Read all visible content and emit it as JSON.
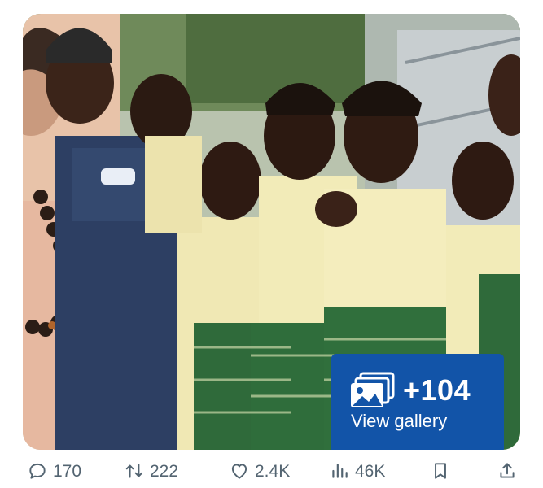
{
  "gallery": {
    "count": "+104",
    "label": "View gallery",
    "icon": "images-icon"
  },
  "actions": {
    "replies": {
      "count": "170",
      "icon": "reply-icon"
    },
    "reposts": {
      "count": "222",
      "icon": "repost-icon"
    },
    "likes": {
      "count": "2.4K",
      "icon": "like-icon"
    },
    "views": {
      "count": "46K",
      "icon": "views-icon"
    },
    "bookmark": {
      "icon": "bookmark-icon"
    },
    "share": {
      "icon": "share-icon"
    }
  },
  "colors": {
    "badge": "#1254a8",
    "action_text": "#536471"
  }
}
